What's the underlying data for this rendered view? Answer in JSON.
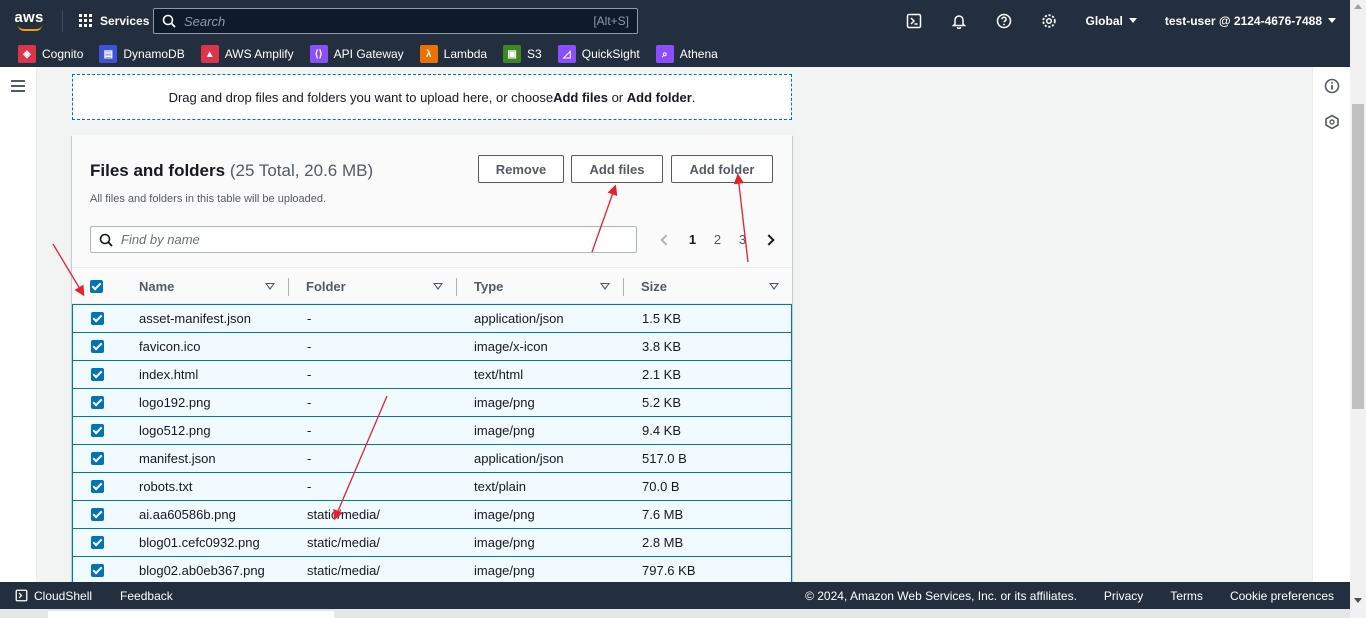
{
  "topnav": {
    "logo_text": "aws",
    "services_label": "Services",
    "search_placeholder": "Search",
    "search_shortcut": "[Alt+S]",
    "region_label": "Global",
    "account_label": "test-user @ 2124-4676-7488",
    "icons": [
      "cloudshell-icon",
      "bell-icon",
      "help-icon",
      "gear-icon"
    ]
  },
  "favorites": [
    {
      "label": "Cognito",
      "color": "#dd344c"
    },
    {
      "label": "DynamoDB",
      "color": "#4053d6"
    },
    {
      "label": "AWS Amplify",
      "color": "#dd344c"
    },
    {
      "label": "API Gateway",
      "color": "#8c4fff"
    },
    {
      "label": "Lambda",
      "color": "#ed7100"
    },
    {
      "label": "S3",
      "color": "#3f8624"
    },
    {
      "label": "QuickSight",
      "color": "#8c4fff"
    },
    {
      "label": "Athena",
      "color": "#8c4fff"
    }
  ],
  "dropzone": {
    "text_before": "Drag and drop files and folders you want to upload here, or choose ",
    "add_files": "Add files",
    "or": " or ",
    "add_folder": "Add folder",
    "period": "."
  },
  "panel": {
    "title": "Files and folders",
    "count": "(25 Total, 20.6 MB)",
    "subtitle": "All files and folders in this table will be uploaded.",
    "remove_label": "Remove",
    "add_files_label": "Add files",
    "add_folder_label": "Add folder",
    "find_placeholder": "Find by name",
    "pages": [
      "1",
      "2",
      "3"
    ],
    "current_page": "1"
  },
  "table": {
    "columns": [
      "Name",
      "Folder",
      "Type",
      "Size"
    ],
    "rows": [
      {
        "name": "asset-manifest.json",
        "folder": "-",
        "type": "application/json",
        "size": "1.5 KB"
      },
      {
        "name": "favicon.ico",
        "folder": "-",
        "type": "image/x-icon",
        "size": "3.8 KB"
      },
      {
        "name": "index.html",
        "folder": "-",
        "type": "text/html",
        "size": "2.1 KB"
      },
      {
        "name": "logo192.png",
        "folder": "-",
        "type": "image/png",
        "size": "5.2 KB"
      },
      {
        "name": "logo512.png",
        "folder": "-",
        "type": "image/png",
        "size": "9.4 KB"
      },
      {
        "name": "manifest.json",
        "folder": "-",
        "type": "application/json",
        "size": "517.0 B"
      },
      {
        "name": "robots.txt",
        "folder": "-",
        "type": "text/plain",
        "size": "70.0 B"
      },
      {
        "name": "ai.aa60586b.png",
        "folder": "static/media/",
        "type": "image/png",
        "size": "7.6 MB"
      },
      {
        "name": "blog01.cefc0932.png",
        "folder": "static/media/",
        "type": "image/png",
        "size": "2.8 MB"
      },
      {
        "name": "blog02.ab0eb367.png",
        "folder": "static/media/",
        "type": "image/png",
        "size": "797.6 KB"
      }
    ]
  },
  "footer": {
    "cloudshell": "CloudShell",
    "feedback": "Feedback",
    "copyright": "© 2024, Amazon Web Services, Inc. or its affiliates.",
    "privacy": "Privacy",
    "terms": "Terms",
    "cookie": "Cookie preferences"
  },
  "colors": {
    "nav_bg": "#232f3e",
    "accent_blue": "#0073bb",
    "annotation_red": "#e8222a",
    "aws_orange": "#ff9900"
  }
}
